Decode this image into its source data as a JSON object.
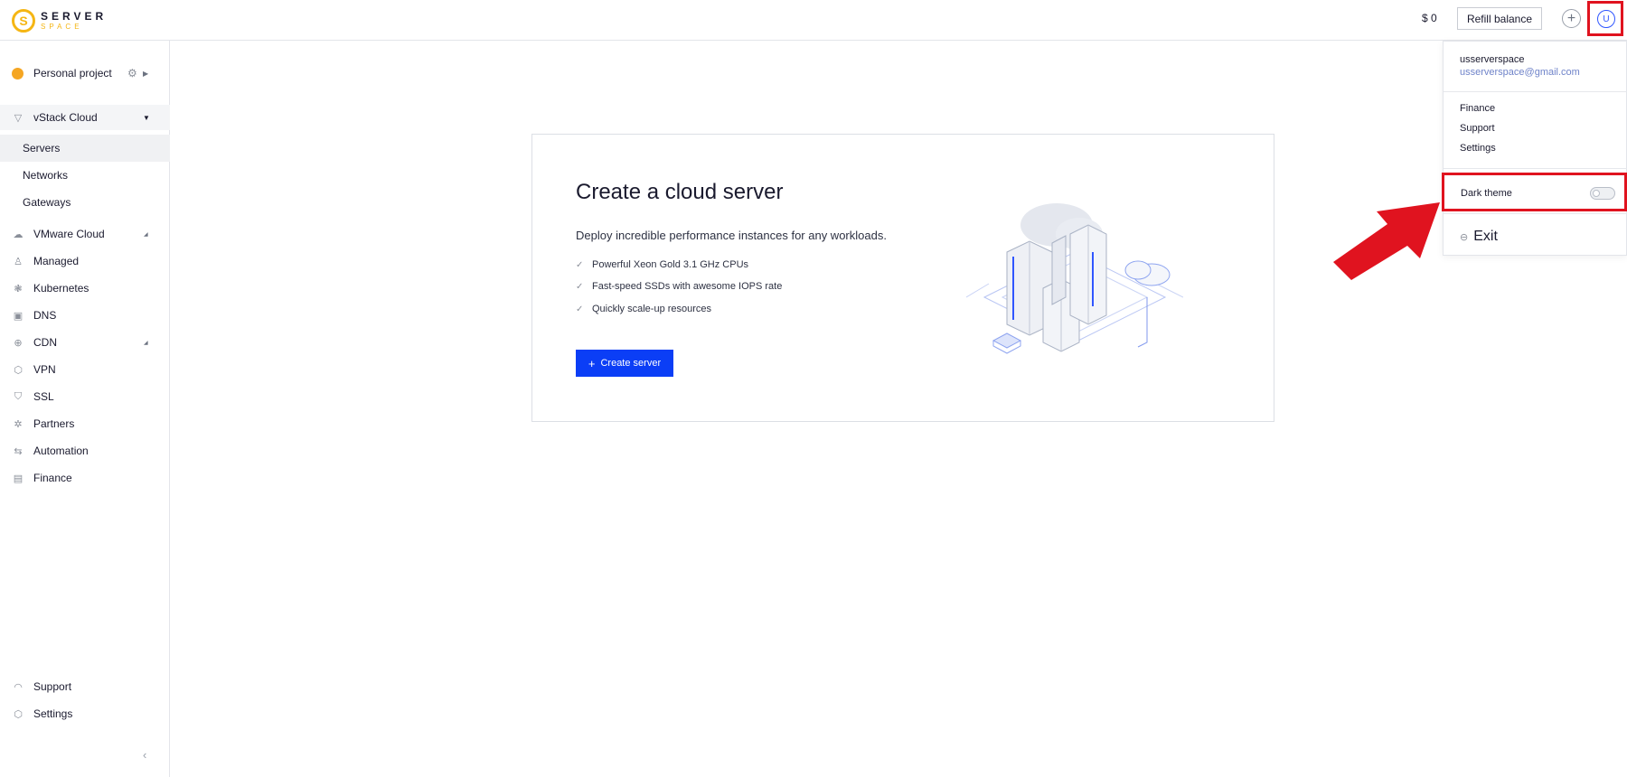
{
  "header": {
    "logo_main": "SERVER",
    "logo_sub": "SPACE",
    "balance": "$ 0",
    "refill_label": "Refill balance",
    "add_icon": "plus-icon",
    "avatar_letter": "U"
  },
  "sidebar": {
    "project_label": "Personal project",
    "vstack_label": "vStack Cloud",
    "vstack_items": [
      {
        "label": "Servers",
        "selected": true
      },
      {
        "label": "Networks"
      },
      {
        "label": "Gateways"
      }
    ],
    "items": [
      {
        "label": "VMware Cloud",
        "icon": "cloud-icon",
        "expandable": true
      },
      {
        "label": "Managed",
        "icon": "person-icon"
      },
      {
        "label": "Kubernetes",
        "icon": "helm-icon"
      },
      {
        "label": "DNS",
        "icon": "dns-icon"
      },
      {
        "label": "CDN",
        "icon": "globe-icon",
        "expandable": true
      },
      {
        "label": "VPN",
        "icon": "shield-hex-icon"
      },
      {
        "label": "SSL",
        "icon": "shield-icon"
      },
      {
        "label": "Partners",
        "icon": "sparkle-icon"
      },
      {
        "label": "Automation",
        "icon": "arrows-icon"
      },
      {
        "label": "Finance",
        "icon": "document-icon"
      }
    ],
    "bottom_items": [
      {
        "label": "Support",
        "icon": "headset-icon"
      },
      {
        "label": "Settings",
        "icon": "hexagon-icon"
      }
    ]
  },
  "main": {
    "title": "Create a cloud server",
    "description": "Deploy incredible performance instances for any workloads.",
    "features": [
      "Powerful Xeon Gold 3.1 GHz CPUs",
      "Fast-speed SSDs with awesome IOPS rate",
      "Quickly scale-up resources"
    ],
    "create_label": "Create server"
  },
  "dropdown": {
    "username": "usserverspace",
    "email": "usserverspace@gmail.com",
    "menu": [
      "Finance",
      "Support",
      "Settings"
    ],
    "dark_theme_label": "Dark theme",
    "dark_theme_on": false,
    "exit_label": "Exit"
  },
  "colors": {
    "accent": "#0b3ef6",
    "brand": "#f5b614",
    "highlight": "#e0131f"
  }
}
